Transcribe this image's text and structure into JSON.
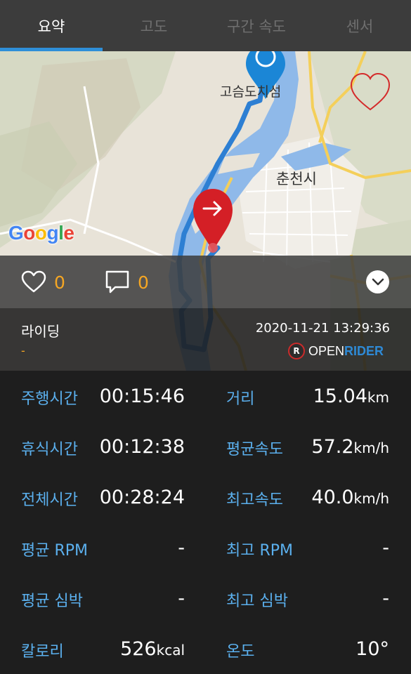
{
  "tabs": [
    {
      "label": "요약"
    },
    {
      "label": "고도"
    },
    {
      "label": "구간 속도"
    },
    {
      "label": "센서"
    }
  ],
  "map": {
    "labels": {
      "gosumdo": "고슴도치섬",
      "chuncheon": "춘천시"
    },
    "google_logo": "Google",
    "colors": {
      "route": "#2d7fd3",
      "start_pin": "#1b86d6",
      "end_pin": "#d41f26",
      "river": "#8fb9e9"
    }
  },
  "social": {
    "likes": "0",
    "comments": "0"
  },
  "ride": {
    "title": "라이딩",
    "subtitle": "-",
    "datetime": "2020-11-21 13:29:36",
    "brand_open": "OPEN",
    "brand_rider": "RIDER",
    "brand_icon_letter": "R"
  },
  "stats": {
    "riding_time": {
      "label": "주행시간",
      "value": "00:15:46"
    },
    "distance": {
      "label": "거리",
      "value": "15.04",
      "unit": "km"
    },
    "rest_time": {
      "label": "휴식시간",
      "value": "00:12:38"
    },
    "avg_speed": {
      "label": "평균속도",
      "value": "57.2",
      "unit": "km/h"
    },
    "total_time": {
      "label": "전체시간",
      "value": "00:28:24"
    },
    "max_speed": {
      "label": "최고속도",
      "value": "40.0",
      "unit": "km/h"
    },
    "avg_rpm": {
      "label": "평균 RPM",
      "value": "-"
    },
    "max_rpm": {
      "label": "최고 RPM",
      "value": "-"
    },
    "avg_hr": {
      "label": "평균 심박",
      "value": "-"
    },
    "max_hr": {
      "label": "최고 심박",
      "value": "-"
    },
    "calories": {
      "label": "칼로리",
      "value": "526",
      "unit": "kcal"
    },
    "temperature": {
      "label": "온도",
      "value": "10°"
    }
  }
}
